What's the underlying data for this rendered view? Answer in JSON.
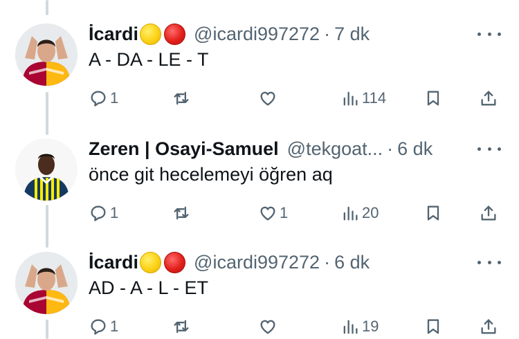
{
  "replies": [
    {
      "name": "İcardi",
      "handle": "@icardi997272",
      "separator": "·",
      "time": "7 dk",
      "text": "A - DA - LE - T",
      "reply_count": "1",
      "retweet_count": "",
      "like_count": "",
      "view_count": "114",
      "name_emojis": [
        "yellow-circle",
        "red-circle"
      ]
    },
    {
      "name": "Zeren | Osayi-Samuel",
      "handle": "@tekgoat...",
      "separator": "·",
      "time": "6 dk",
      "text": "önce git hecelemeyi öğren aq",
      "reply_count": "1",
      "retweet_count": "",
      "like_count": "1",
      "view_count": "20",
      "name_emojis": []
    },
    {
      "name": "İcardi",
      "handle": "@icardi997272",
      "separator": "·",
      "time": "6 dk",
      "text": "AD - A - L - ET",
      "reply_count": "1",
      "retweet_count": "",
      "like_count": "",
      "view_count": "19",
      "name_emojis": [
        "yellow-circle",
        "red-circle"
      ]
    }
  ],
  "icons": {
    "reply": "speech-bubble-icon",
    "retweet": "retweet-arrows-icon",
    "like": "heart-icon",
    "views": "bar-chart-icon",
    "bookmark": "bookmark-icon",
    "share": "share-upload-icon",
    "more": "more-dots-icon"
  },
  "colors": {
    "text": "#0f1419",
    "secondary": "#536471",
    "thread_line": "#cfd9de",
    "emoji_yellow": "#fcd116",
    "emoji_red": "#e3201b",
    "avatar_gs_red": "#a90432",
    "avatar_gs_yellow": "#fdb912",
    "avatar_fb_navy": "#163962",
    "avatar_fb_yellow": "#ffed00"
  }
}
